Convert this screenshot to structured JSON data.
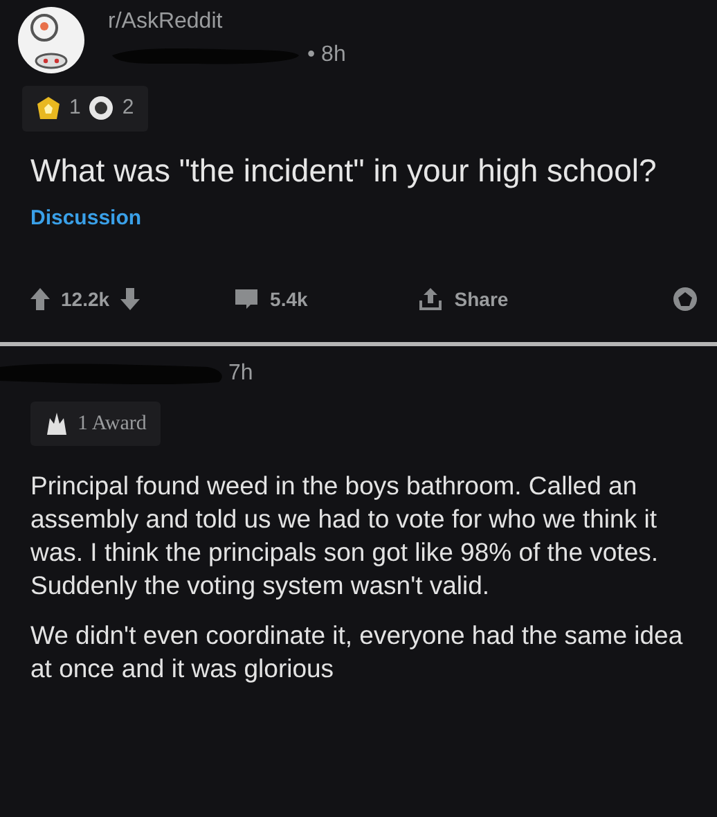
{
  "post": {
    "subreddit": "r/AskReddit",
    "age": "• 8h",
    "awards": [
      {
        "kind": "gold",
        "count": "1"
      },
      {
        "kind": "silver",
        "count": "2"
      }
    ],
    "title": "What was \"the incident\" in your high school?",
    "flair": "Discussion",
    "votes": "12.2k",
    "comments": "5.4k",
    "share": "Share"
  },
  "comment": {
    "age": "7h",
    "award": "1 Award",
    "paragraphs": [
      "Principal found weed in the boys bathroom. Called an assembly and told us we had to vote for who we think it was. I think the principals son got like 98% of the votes. Suddenly the voting system wasn't valid.",
      "We didn't even coordinate it, everyone had the same idea at once and it was glorious"
    ]
  }
}
